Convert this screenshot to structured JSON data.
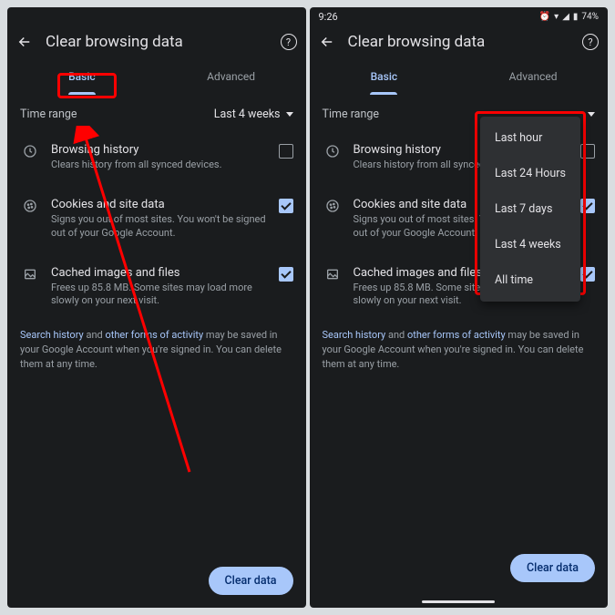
{
  "statusbar": {
    "time": "9:26",
    "battery": "74%"
  },
  "appbar": {
    "title": "Clear browsing data"
  },
  "tabs": {
    "basic": "Basic",
    "advanced": "Advanced"
  },
  "timerange": {
    "label": "Time range",
    "value": "Last 4 weeks"
  },
  "options": {
    "history": {
      "title": "Browsing history",
      "sub": "Clears history from all synced devices."
    },
    "history2": {
      "title": "Browsing history",
      "sub": "Clears history from all synced devices."
    },
    "cookies": {
      "title": "Cookies and site data",
      "sub": "Signs you out of most sites. You won't be signed out of your Google Account."
    },
    "cookies2": {
      "title": "Cookies and site data",
      "sub": "Signs you out of most sites. You won't be signed out of your Google Account."
    },
    "cache": {
      "title": "Cached images and files",
      "sub": "Frees up 85.8 MB. Some sites may load more slowly on your next visit."
    },
    "cache2": {
      "title": "Cached images and files",
      "sub": "Frees up 85.8 MB. Some sites may load more slowly on your next visit."
    }
  },
  "note": {
    "link1": "Search history",
    "mid1": " and ",
    "link2": "other forms of activity",
    "rest": " may be saved in your Google Account when you're signed in. You can delete them at any time."
  },
  "button": {
    "clear": "Clear data"
  },
  "dropdown": {
    "i0": "Last hour",
    "i1": "Last 24 Hours",
    "i2": "Last 7 days",
    "i3": "Last 4 weeks",
    "i4": "All time"
  }
}
